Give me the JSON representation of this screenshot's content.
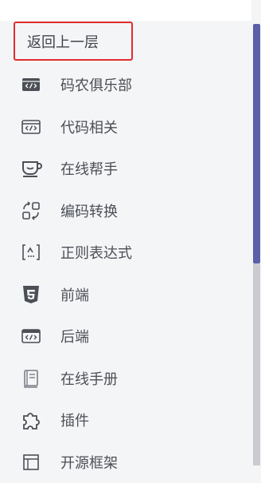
{
  "back_button": {
    "label": "返回上一层"
  },
  "menu": {
    "items": [
      {
        "label": "码农俱乐部",
        "icon": "code-window-icon"
      },
      {
        "label": "代码相关",
        "icon": "code-window-outline-icon"
      },
      {
        "label": "在线帮手",
        "icon": "coffee-cup-icon"
      },
      {
        "label": "编码转换",
        "icon": "convert-icon"
      },
      {
        "label": "正则表达式",
        "icon": "regex-icon"
      },
      {
        "label": "前端",
        "icon": "html5-icon"
      },
      {
        "label": "后端",
        "icon": "code-window-icon"
      },
      {
        "label": "在线手册",
        "icon": "book-icon"
      },
      {
        "label": "插件",
        "icon": "puzzle-icon"
      },
      {
        "label": "开源框架",
        "icon": "frame-icon"
      }
    ]
  },
  "colors": {
    "accent": "#5a5fa8",
    "highlight_border": "#e02c2c"
  }
}
